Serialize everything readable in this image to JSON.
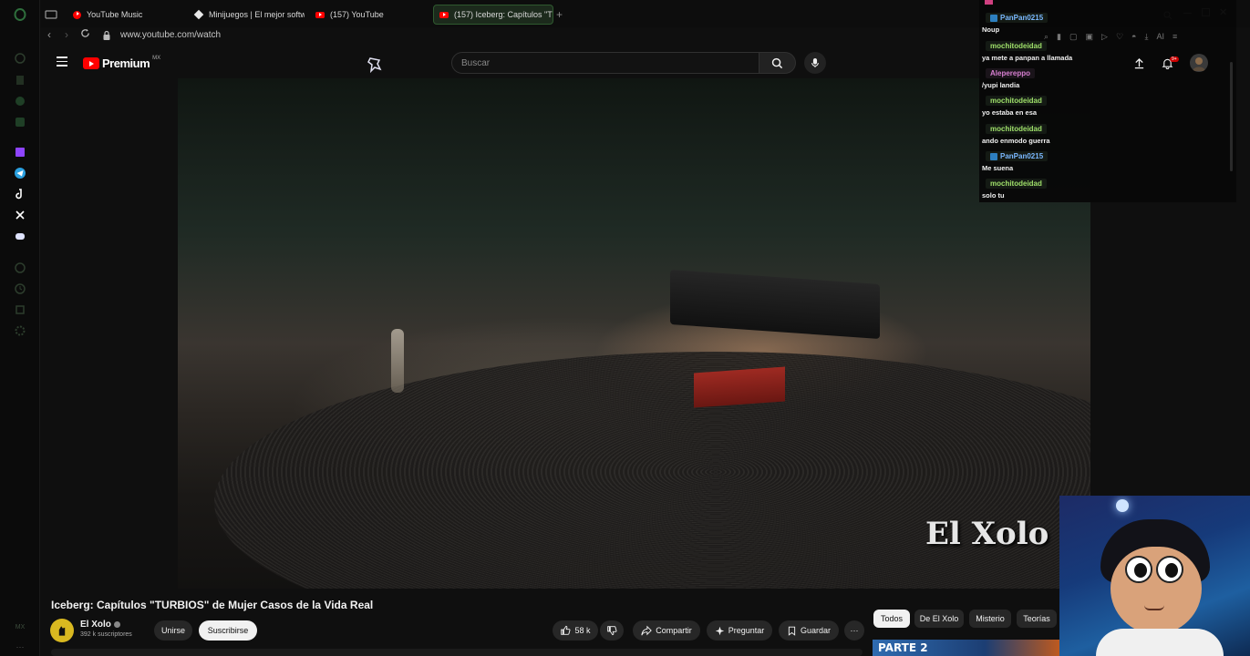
{
  "browser": {
    "tabs": [
      {
        "title": "YouTube Music",
        "icon": "youtube-icon"
      },
      {
        "title": "Minijuegos | El mejor softw",
        "icon": "site-icon"
      },
      {
        "title": "(157) YouTube",
        "icon": "youtube-icon"
      },
      {
        "title": "(157) Iceberg: Capítulos \"T",
        "icon": "youtube-icon",
        "active": true
      }
    ],
    "new_tab": "+",
    "url": "www.youtube.com/watch"
  },
  "youtube": {
    "logo_text": "Premium",
    "region": "MX",
    "search_placeholder": "Buscar",
    "notification_count": "9+"
  },
  "video": {
    "watermark": "El Xolo",
    "title": "Iceberg: Capítulos \"TURBIOS\" de Mujer Casos de la Vida Real",
    "channel": "El Xolo",
    "subscribers": "392 k suscriptores",
    "join_label": "Unirse",
    "subscribe_label": "Suscribirse",
    "likes": "58 k",
    "share_label": "Compartir",
    "ask_label": "Preguntar",
    "save_label": "Guardar",
    "more_label": "···"
  },
  "chips": [
    "Todos",
    "De El Xolo",
    "Misterio",
    "Teorías"
  ],
  "thumbnail_text": "PARTE 2",
  "chat": [
    {
      "user": "PanPan0215",
      "message": "Noup",
      "color": "#7ab8ff",
      "badge": true
    },
    {
      "user": "mochitodeidad",
      "message": "ya mete a panpan a llamada",
      "color": "#9fe06a"
    },
    {
      "user": "Alepereppo",
      "message": "/yupi landia",
      "color": "#d77fd1"
    },
    {
      "user": "mochitodeidad",
      "message": "yo estaba en esa",
      "color": "#9fe06a"
    },
    {
      "user": "mochitodeidad",
      "message": "ando enmodo guerra",
      "color": "#9fe06a"
    },
    {
      "user": "PanPan0215",
      "message": "Me suena",
      "color": "#7ab8ff",
      "badge": true
    },
    {
      "user": "mochitodeidad",
      "message": "solo tu",
      "color": "#9fe06a"
    }
  ],
  "colors": {
    "youtube_red": "#ff0000",
    "accent_green": "#2f5a2f",
    "background": "#0f0f0f"
  },
  "sidebar_footer": "MX",
  "toolbar_ai": "AI"
}
